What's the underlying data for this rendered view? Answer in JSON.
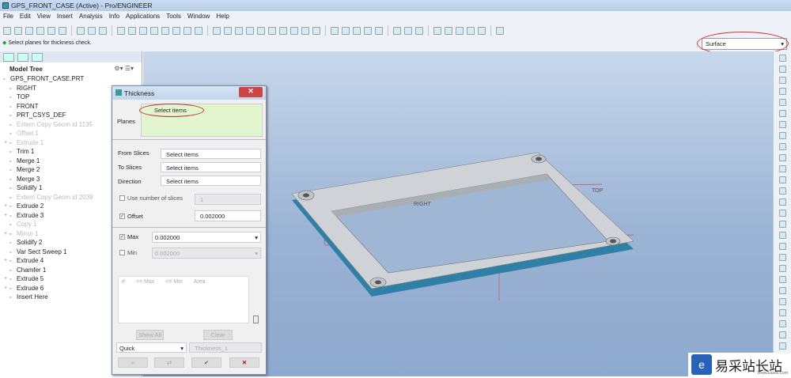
{
  "window": {
    "title": "GPS_FRONT_CASE (Active) - Pro/ENGINEER"
  },
  "menu": [
    "File",
    "Edit",
    "View",
    "Insert",
    "Analysis",
    "Info",
    "Applications",
    "Tools",
    "Window",
    "Help"
  ],
  "status": "Select planes for thickness check.",
  "filter": {
    "value": "Surface"
  },
  "model_tree": {
    "title": "Model Tree",
    "items": [
      {
        "label": "GPS_FRONT_CASE.PRT",
        "icon": "part-icon",
        "dim": false,
        "root": true
      },
      {
        "label": "RIGHT",
        "icon": "datum-plane-icon"
      },
      {
        "label": "TOP",
        "icon": "datum-plane-icon"
      },
      {
        "label": "FRONT",
        "icon": "datum-plane-icon"
      },
      {
        "label": "PRT_CSYS_DEF",
        "icon": "csys-icon"
      },
      {
        "label": "Extern Copy Geom id 1135",
        "icon": "copy-geom-icon",
        "dim": true
      },
      {
        "label": "Offset 1",
        "icon": "offset-icon",
        "dim": true
      },
      {
        "label": "Extrude 1",
        "icon": "extrude-icon",
        "dim": true,
        "expand": true
      },
      {
        "label": "Trim 1",
        "icon": "trim-icon"
      },
      {
        "label": "Merge 1",
        "icon": "merge-icon"
      },
      {
        "label": "Merge 2",
        "icon": "merge-icon"
      },
      {
        "label": "Merge 3",
        "icon": "merge-icon"
      },
      {
        "label": "Solidify 1",
        "icon": "solidify-icon"
      },
      {
        "label": "Extern Copy Geom id 2039",
        "icon": "copy-geom-icon",
        "dim": true
      },
      {
        "label": "Extrude 2",
        "icon": "extrude-icon",
        "expand": true
      },
      {
        "label": "Extrude 3",
        "icon": "extrude-icon",
        "expand": true
      },
      {
        "label": "Copy 1",
        "icon": "copy-icon",
        "dim": true
      },
      {
        "label": "Mirror 1",
        "icon": "mirror-icon",
        "dim": true,
        "expand": true
      },
      {
        "label": "Solidify 2",
        "icon": "solidify-icon"
      },
      {
        "label": "Var Sect Sweep 1",
        "icon": "sweep-icon"
      },
      {
        "label": "Extrude 4",
        "icon": "extrude-icon",
        "expand": true
      },
      {
        "label": "Chamfer 1",
        "icon": "chamfer-icon"
      },
      {
        "label": "Extrude 5",
        "icon": "extrude-icon",
        "expand": true
      },
      {
        "label": "Extrude 6",
        "icon": "extrude-icon",
        "expand": true
      },
      {
        "label": "Insert Here",
        "icon": "insert-here-icon"
      }
    ]
  },
  "dialog": {
    "title": "Thickness",
    "planes_label": "Planes",
    "planes_value": "Select items",
    "from_slices_label": "From Slices",
    "from_slices_value": "Select items",
    "to_slices_label": "To Slices",
    "to_slices_value": "Select items",
    "direction_label": "Direction",
    "direction_value": "Select items",
    "use_slices_label": "Use number of slices",
    "use_slices_value": "1",
    "offset_label": "Offset",
    "offset_value": "0.002000",
    "max_label": "Max",
    "max_value": "0.002000",
    "min_label": "Min",
    "min_value": "0.002000",
    "columns": [
      "#",
      ">= Max",
      "<= Min",
      "Area"
    ],
    "show_all": "Show All",
    "clear": "Clear",
    "mode": "Quick",
    "name": "Thickness_1"
  },
  "viewport": {
    "plane_labels": [
      "RIGHT",
      "TOP"
    ]
  },
  "watermark": {
    "text": "易采站长站",
    "sub": "Www.Easck.Com"
  }
}
